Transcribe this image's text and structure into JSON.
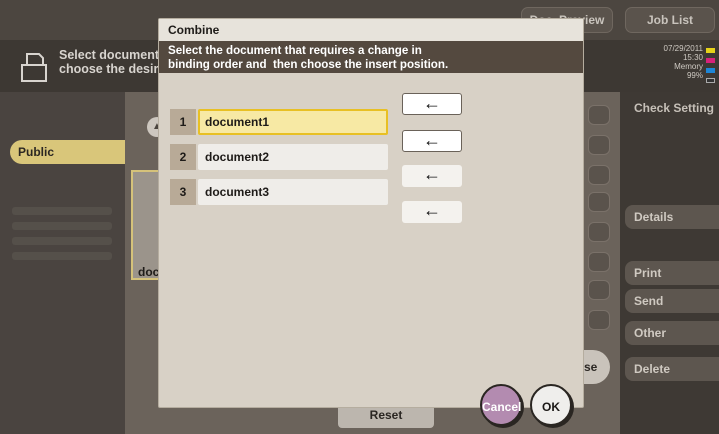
{
  "background": {
    "header_text": "Select document(\nchoose the desire",
    "top_buttons": {
      "doc_preview": "Doc. Preview",
      "job_list": "Job List"
    },
    "status": {
      "date": "07/29/2011",
      "time": "15:30",
      "memory_label": "Memory",
      "memory_value": "99%",
      "toner": [
        "Y",
        "M",
        "C",
        "K"
      ],
      "toner_colors": [
        "#e6d21a",
        "#d8227a",
        "#1e86d6",
        "#333333"
      ]
    },
    "public_tab": "Public",
    "thumb_label": "doc",
    "right_panel": {
      "check_setting": "Check Setting",
      "details": "Details",
      "print": "Print",
      "send": "Send",
      "other": "Other",
      "delete": "Delete"
    },
    "close_pill": "se",
    "reset": "Reset"
  },
  "dialog": {
    "title": "Combine",
    "message": "Select the document that requires a change in\nbinding order and  then choose the insert position.",
    "documents": [
      {
        "num": "1",
        "name": "document1",
        "selected": true
      },
      {
        "num": "2",
        "name": "document2",
        "selected": false
      },
      {
        "num": "3",
        "name": "document3",
        "selected": false
      }
    ],
    "arrow_glyph": "←",
    "cancel": "Cancel",
    "ok": "OK"
  },
  "colors": {
    "selection": "#e8c024",
    "cancel_accent": "#b38bb0",
    "message_bar": "#54493f"
  }
}
